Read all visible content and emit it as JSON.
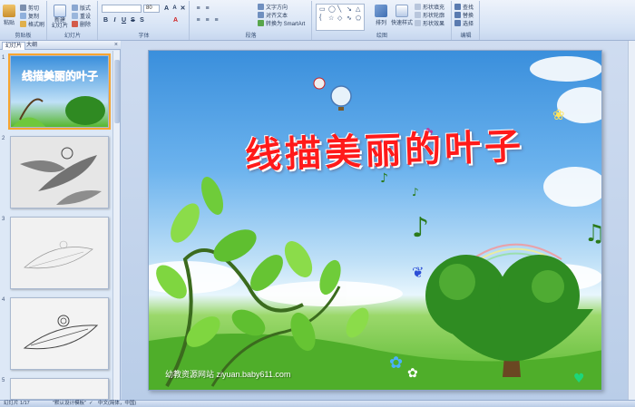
{
  "ribbon": {
    "clipboard": {
      "paste": "粘贴",
      "cut": "剪切",
      "copy": "复制",
      "format_painter": "格式刷",
      "label": "剪贴板"
    },
    "slides": {
      "new_slide": "新建\n幻灯片",
      "layout": "版式",
      "reset": "重设",
      "delete": "删除",
      "label": "幻灯片"
    },
    "font": {
      "font_name": "",
      "font_size": "80",
      "label": "字体"
    },
    "paragraph": {
      "text_direction": "文字方向",
      "align_text": "对齐文本",
      "smartart": "转换为 SmartArt",
      "label": "段落"
    },
    "drawing": {
      "arrange": "排列",
      "quick_styles": "快速样式",
      "shape_fill": "形状填充",
      "shape_outline": "形状轮廓",
      "shape_effects": "形状效果",
      "label": "绘图"
    },
    "editing": {
      "find": "查找",
      "replace": "替换",
      "select": "选择",
      "label": "编辑"
    }
  },
  "pane": {
    "tab_slides": "幻灯片",
    "tab_outline": "大纲",
    "close": "×",
    "thumbnails": [
      {
        "num": "1"
      },
      {
        "num": "2"
      },
      {
        "num": "3"
      },
      {
        "num": "4"
      },
      {
        "num": "5"
      }
    ]
  },
  "slide": {
    "title": "线描美丽的叶子",
    "watermark": "幼教资源网站  ziyuan.baby611.com"
  },
  "status": {
    "slide_count": "幻灯片 1/17",
    "theme": "\"默认设计模板\"",
    "language": "中文(简体，中国)"
  }
}
